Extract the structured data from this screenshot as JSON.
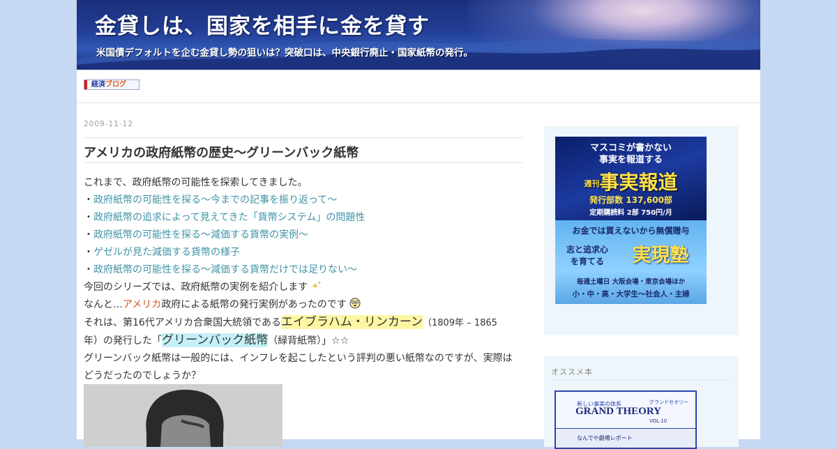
{
  "header": {
    "title": "金貸しは、国家を相手に金を貸す",
    "subtitle": "米国債デフォルトを企む金貸し勢の狙いは？突破口は、中央銀行廃止・国家紙幣の発行。"
  },
  "badge": {
    "part1": "経済",
    "part2": "ブログ"
  },
  "post": {
    "date": "2009-11-12",
    "title": "アメリカの政府紙幣の歴史〜グリーンバック紙幣",
    "intro": "これまで、政府紙幣の可能性を探索してきました。",
    "bullet": "・",
    "links": [
      "政府紙幣の可能性を探る〜今までの記事を振り返って〜",
      "政府紙幣の追求によって見えてきた「貨幣システム」の問題性",
      "政府紙幣の可能性を探る〜減価する貨幣の実例〜",
      "ゲゼルが見た減価する貨幣の様子",
      "政府紙幣の可能性を探る〜減価する貨幣だけでは足りない〜"
    ],
    "series_line": "今回のシリーズでは、政府紙幣の実例を紹介します",
    "america_pre": "なんと…",
    "america_link": "アメリカ",
    "america_post": "政府による紙幣の発行実例があったのです",
    "lincoln_pre": "それは、第16代アメリカ合衆国大統領である",
    "lincoln_name": "エイブラハム・リンカーン",
    "lincoln_years": "（1809年 – 1865",
    "issue_pre": "年）の発行した「",
    "greenback": "グリーンバック紙幣",
    "issue_post": "（緑背紙幣）」☆☆",
    "question1": "グリーンバック紙幣は一般的には、インフレを起こしたという評判の悪い紙幣なのですが、実際は",
    "question2": "どうだったのでしょうか？"
  },
  "sidebar": {
    "ad": {
      "line1": "マスコミが書かない",
      "line2": "事実を報道する",
      "weekly": "週刊",
      "name": "事実報道",
      "circulation": "発行部数 137,600部",
      "subscription": "定期購読料 2部 750円/月",
      "free": "お金では買えないから無償贈与",
      "kokorozashi1": "志と追求心",
      "kokorozashi2": "を育てる",
      "school": "実現塾",
      "schedule": "毎週土曜日 大阪会場・東京会場ほか",
      "audience": "小・中・高・大学生〜社会人・主婦"
    },
    "recommend_heading": "オススメ本",
    "book": {
      "series": "新しい事実の体系",
      "kana": "グランドセオリー",
      "title": "GRAND THEORY",
      "vol": "VOL.10",
      "sub": "なんでや劇場レポート"
    }
  },
  "colors": {
    "link": "#3f93a6",
    "link_red": "#d2561a",
    "highlight_yellow": "#fdf6a3",
    "highlight_cyan": "#c4f0f6",
    "sidebar_bg": "#eef6fb",
    "page_bg": "#c6d8f2"
  }
}
